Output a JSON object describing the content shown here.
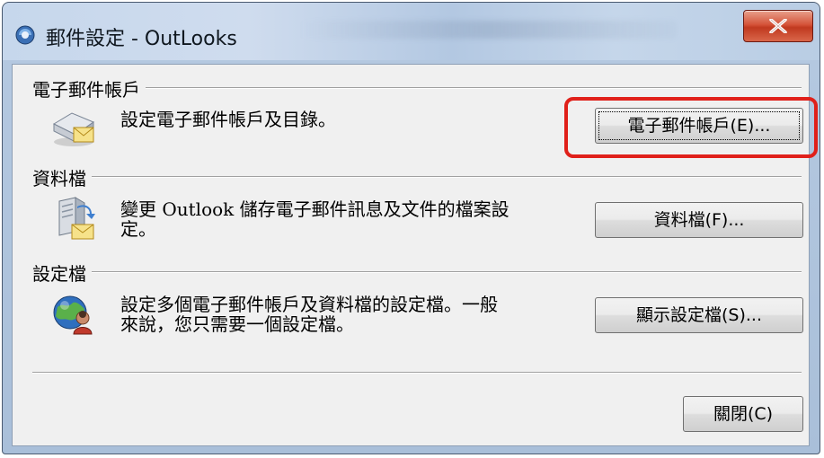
{
  "window": {
    "title": "郵件設定 - OutLooks",
    "close_label": "X"
  },
  "sections": [
    {
      "heading": "電子郵件帳戶",
      "description_line1": "設定電子郵件帳戶及目錄。",
      "description_line2": "",
      "button_label": "電子郵件帳戶(E)...",
      "icon": "email-accounts-icon"
    },
    {
      "heading": "資料檔",
      "description_line1": "變更 Outlook 儲存電子郵件訊息及文件的檔案設",
      "description_line2": "定。",
      "button_label": "資料檔(F)...",
      "icon": "data-files-icon"
    },
    {
      "heading": "設定檔",
      "description_line1": "設定多個電子郵件帳戶及資料檔的設定檔。一般",
      "description_line2": "來說，您只需要一個設定檔。",
      "button_label": "顯示設定檔(S)...",
      "icon": "profiles-icon"
    }
  ],
  "footer": {
    "close_button_label": "關閉(C)"
  },
  "colors": {
    "highlight": "#e0201a",
    "close_button": "#c0391f"
  }
}
